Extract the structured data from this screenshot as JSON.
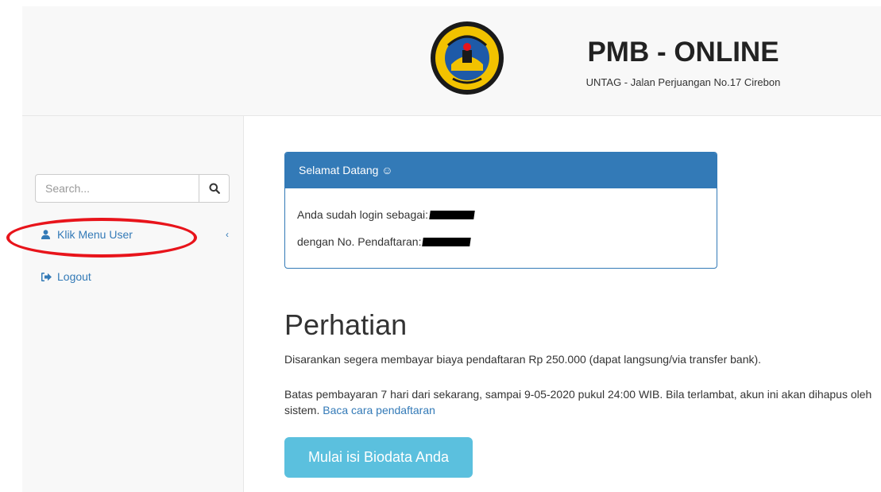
{
  "header": {
    "title": "PMB - ONLINE",
    "subtitle": "UNTAG - Jalan Perjuangan No.17 Cirebon",
    "logo_icon": "university-seal-logo"
  },
  "sidebar": {
    "search": {
      "placeholder": "Search...",
      "value": ""
    },
    "items": [
      {
        "label": "Klik Menu User",
        "icon": "user-icon",
        "chevron": "‹"
      },
      {
        "label": "Logout",
        "icon": "logout-icon"
      }
    ]
  },
  "welcome_panel": {
    "heading": "Selamat Datang ☺",
    "login_label": "Anda sudah login sebagai:",
    "registration_label": "dengan No. Pendaftaran:"
  },
  "notice": {
    "title": "Perhatian",
    "paragraph1": "Disarankan segera membayar biaya pendaftaran Rp 250.000 (dapat langsung/via transfer bank).",
    "paragraph2": "Batas pembayaran 7 hari dari sekarang, sampai 9-05-2020 pukul 24:00 WIB. Bila terlambat, akun ini akan dihapus oleh sistem.",
    "link_text": "Baca cara pendaftaran",
    "button_label": "Mulai isi Biodata Anda"
  },
  "colors": {
    "primary": "#337ab7",
    "info_button": "#5bc0de",
    "highlight": "#e8141b"
  }
}
